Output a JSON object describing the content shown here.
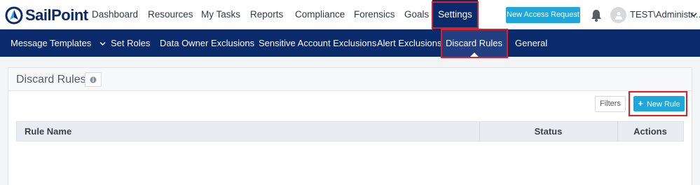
{
  "brand": {
    "logo_text": "SailPoint",
    "brand_color": "#0b2a6b",
    "accent_color": "#1fa6db",
    "highlight_color": "#e02020"
  },
  "topnav": {
    "items": [
      {
        "label": "Dashboard"
      },
      {
        "label": "Resources"
      },
      {
        "label": "My Tasks"
      },
      {
        "label": "Reports"
      },
      {
        "label": "Compliance"
      },
      {
        "label": "Forensics"
      },
      {
        "label": "Goals"
      },
      {
        "label": "Settings",
        "active": true
      }
    ],
    "new_access_request_label": "New Access Request",
    "notifications_icon": "bell-icon",
    "avatar_icon": "user-avatar-icon",
    "user_label": "TEST\\Administr..."
  },
  "subnav": {
    "items": [
      {
        "label": "Message Templates",
        "has_dropdown": true
      },
      {
        "label": "Set Roles"
      },
      {
        "label": "Data Owner Exclusions"
      },
      {
        "label": "Sensitive Account Exclusions"
      },
      {
        "label": "Alert Exclusions"
      },
      {
        "label": "Discard Rules",
        "active": true
      },
      {
        "label": "General"
      }
    ]
  },
  "panel": {
    "title": "Discard Rules",
    "info_icon": "info-icon",
    "filters_label": "Filters",
    "new_rule_label": "New Rule",
    "new_rule_icon": "plus-icon",
    "table": {
      "columns": [
        "Rule Name",
        "Status",
        "Actions"
      ],
      "rows": []
    }
  }
}
